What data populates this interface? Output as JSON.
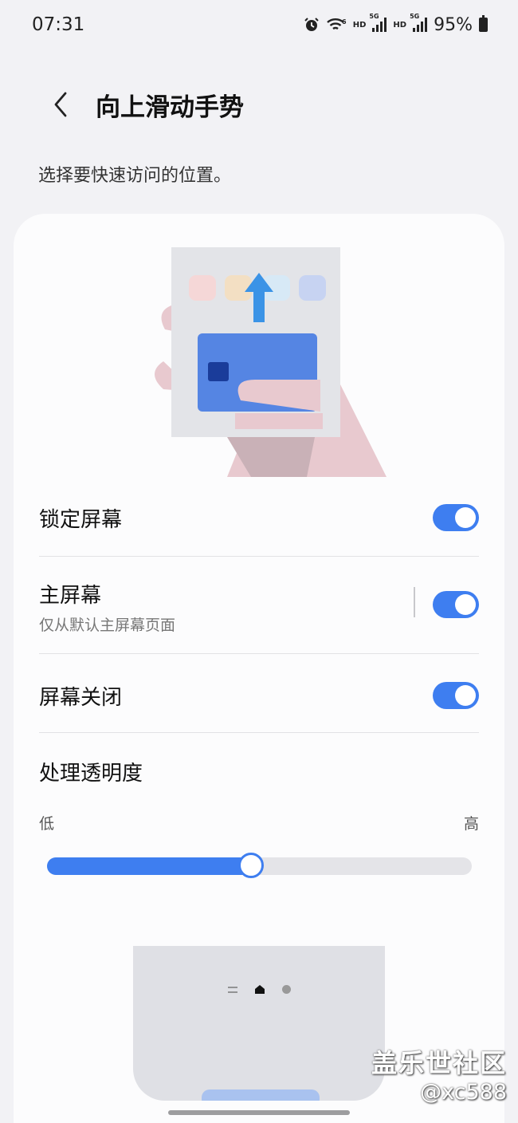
{
  "status": {
    "time": "07:31",
    "battery": "95%",
    "icons": [
      "alarm-icon",
      "wifi-icon",
      "hd-icon",
      "signal-5g-icon",
      "hd-icon",
      "signal-5g-icon",
      "battery-icon"
    ],
    "hd_label": "HD",
    "g5_label": "5G"
  },
  "header": {
    "title": "向上滑动手势",
    "back_icon": "chevron-left-icon"
  },
  "subtitle": "选择要快速访问的位置。",
  "settings": [
    {
      "label": "锁定屏幕",
      "enabled": true
    },
    {
      "label": "主屏幕",
      "sub": "仅从默认主屏幕页面",
      "enabled": true
    },
    {
      "label": "屏幕关闭",
      "enabled": true
    }
  ],
  "transparency": {
    "label": "处理透明度",
    "low": "低",
    "high": "高",
    "value_fraction": 0.48
  },
  "colors": {
    "accent": "#3e7ef0",
    "background": "#f2f2f5",
    "card": "#fcfcfd"
  },
  "watermark": {
    "line1": "盖乐世社区",
    "line2": "@xc588"
  }
}
